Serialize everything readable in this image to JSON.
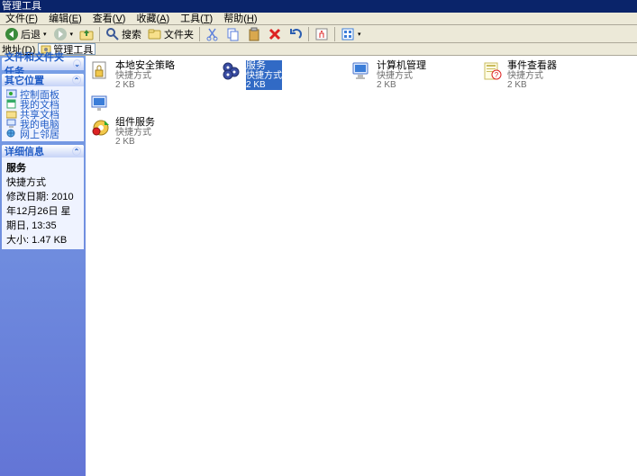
{
  "title": "管理工具",
  "menubar": {
    "file": {
      "label": "文件",
      "accel": "F"
    },
    "edit": {
      "label": "编辑",
      "accel": "E"
    },
    "view": {
      "label": "查看",
      "accel": "V"
    },
    "fav": {
      "label": "收藏",
      "accel": "A"
    },
    "tools": {
      "label": "工具",
      "accel": "T"
    },
    "help": {
      "label": "帮助",
      "accel": "H"
    }
  },
  "toolbar": {
    "back": "后退",
    "search": "搜索",
    "folders": "文件夹"
  },
  "addressbar": {
    "label": "地址",
    "accel": "D",
    "value": "管理工具"
  },
  "sidebar": {
    "tasks_hd": "文件和文件夹任务",
    "places_hd": "其它位置",
    "places": [
      {
        "label": "控制面板"
      },
      {
        "label": "我的文档"
      },
      {
        "label": "共享文档"
      },
      {
        "label": "我的电脑"
      },
      {
        "label": "网上邻居"
      }
    ],
    "details_hd": "详细信息",
    "details": {
      "name": "服务",
      "type": "快捷方式",
      "mod_label": "修改日期: ",
      "mod_value": "2010年12月26日 星期日, 13:35",
      "size_label": "大小: ",
      "size_value": "1.47 KB"
    }
  },
  "files": [
    {
      "name": "本地安全策略",
      "desc": "快捷方式",
      "size": "2 KB",
      "selected": false
    },
    {
      "name": "服务",
      "desc": "快捷方式",
      "size": "2 KB",
      "selected": true
    },
    {
      "name": "计算机管理",
      "desc": "快捷方式",
      "size": "2 KB",
      "selected": false
    },
    {
      "name": "事件查看器",
      "desc": "快捷方式",
      "size": "2 KB",
      "selected": false
    },
    {
      "name": "",
      "desc": "",
      "size": "",
      "selected": false,
      "placeholder": true
    },
    {
      "name": "组件服务",
      "desc": "快捷方式",
      "size": "2 KB",
      "selected": false
    }
  ]
}
